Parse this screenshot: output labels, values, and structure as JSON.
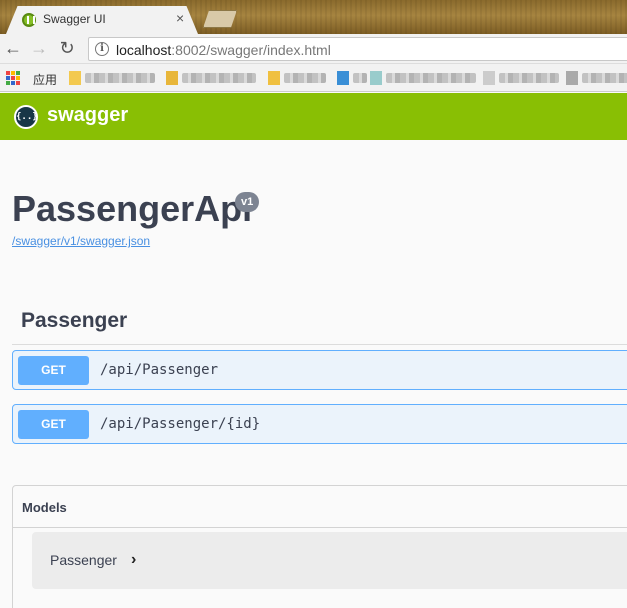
{
  "browser": {
    "tab_title": "Swagger UI",
    "tab_close": "×",
    "url_host": "localhost",
    "url_rest": ":8002/swagger/index.html",
    "back_icon": "arrow-left-icon",
    "forward_icon": "arrow-right-icon",
    "reload_icon": "reload-icon",
    "info_icon": "info-icon",
    "info_glyph": "i",
    "bookmarks_apps_label": "应用",
    "back_glyph": "←",
    "forward_glyph": "→",
    "reload_glyph": "↻"
  },
  "swagger": {
    "logo_glyph": "{..}",
    "logo_text": "swagger",
    "topbar_color": "#89bf04",
    "api_title": "PassengerApi",
    "version": "v1",
    "spec_link": "/swagger/v1/swagger.json",
    "tag": "Passenger",
    "operations": [
      {
        "method": "GET",
        "path": "/api/Passenger"
      },
      {
        "method": "GET",
        "path": "/api/Passenger/{id}"
      }
    ],
    "get_color": "#61affe",
    "models": {
      "title": "Models",
      "items": [
        {
          "name": "Passenger",
          "chevron": "›"
        }
      ]
    }
  }
}
